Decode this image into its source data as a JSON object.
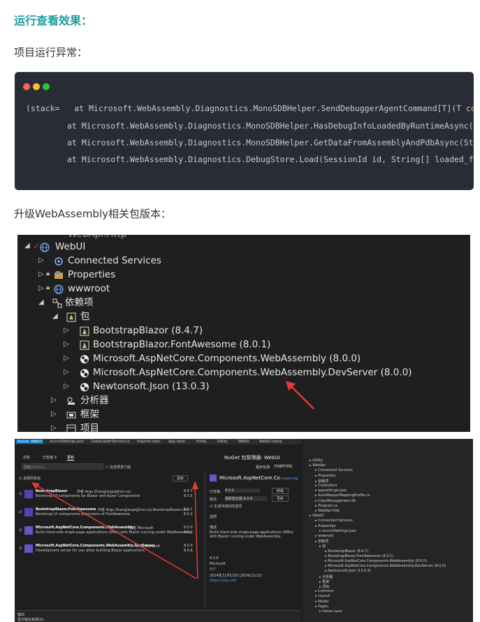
{
  "heading": "运行查看效果：",
  "para1": "项目运行异常：",
  "code": {
    "dots": [
      "#ff5f56",
      "#ffbd2e",
      "#27c93f"
    ],
    "line1_prefix": "(stack=   at Microsoft.WebAssembly.Diagnostics.MonoSDBHelper.SendDebuggerAgentCommand[T](T ",
    "line1_kw": "command",
    "line2": "at Microsoft.WebAssembly.Diagnostics.MonoSDBHelper.HasDebugInfoLoadedByRuntimeAsync(Strin",
    "line3": "at Microsoft.WebAssembly.Diagnostics.MonoSDBHelper.GetDataFromAssemblyAndPdbAsync(String",
    "line4": "at Microsoft.WebAssembly.Diagnostics.DebugStore.Load(SessionId id, String[] loaded_files"
  },
  "para2": "升级WebAssembly相关包版本：",
  "solution_tree": {
    "partial_top": "WebApi.Http",
    "webui": "WebUI",
    "connected_services": "Connected Services",
    "properties": "Properties",
    "wwwroot": "wwwroot",
    "dependencies": "依赖项",
    "packages": "包",
    "pkg1": "BootstrapBlazor (8.4.7)",
    "pkg2": "BootstrapBlazor.FontAwesome (8.0.1)",
    "pkg3": "Microsoft.AspNetCore.Components.WebAssembly (8.0.0)",
    "pkg4": "Microsoft.AspNetCore.Components.WebAssembly.DevServer (8.0.0)",
    "pkg5": "Newtonsoft.Json (13.0.3)",
    "analyzers": "分析器",
    "frameworks": "框架",
    "project": "项目"
  },
  "nuget": {
    "tabs": [
      "NuGet: WebUI",
      "launchSettings.json",
      "DataLoaderService.cs",
      "Imports.razor",
      "App.razor",
      "Entity",
      "Utility",
      "WebUI",
      "WebUI.csproj"
    ],
    "browse": "浏览",
    "installed": "已安装 9",
    "updates": "更新",
    "title": "NuGet 包管理器: WebUI",
    "search": "搜索(Ctrl+L)",
    "prerelease": "包括预发行版",
    "source_label": "程序包源:",
    "source": "nuget.org",
    "select_all": "选择所有包",
    "update_btn": "更新",
    "packages": [
      {
        "name": "BootstrapBlazor",
        "by": "作者 Argo Zhang(argo@live.ca)",
        "desc": "Bootstrap UI components for Blazor and Razor Components",
        "v1": "8.4.7",
        "v2": "8.5.5"
      },
      {
        "name": "BootstrapBlazor.FontAwesome",
        "by": "作者 Argo Zhang(argo@live.ca),BootstrapBlazor.com",
        "desc": "Bootstrap UI components extensions of FontAwesome",
        "v1": "8.0.1",
        "v2": "8.0.2"
      },
      {
        "name": "Microsoft.AspNetCore.Components.WebAssembly",
        "by": "作者 Microsoft",
        "desc": "Build client-side single-page applications (SPAs) with Blazor running under WebAssembly.",
        "v1": "8.0.0",
        "v2": "8.0.6"
      },
      {
        "name": "Microsoft.AspNetCore.Components.WebAssembly.DevServer",
        "by": "作者 Microsoft",
        "desc": "Development server for use when building Blazor applications.",
        "v1": "8.0.0",
        "v2": "8.0.6"
      }
    ],
    "detail": {
      "title": "Microsoft.AspNetCore.Co",
      "link": "nuget.org",
      "installed_label": "已安装:",
      "installed_val": "8.0.0",
      "uninstall": "卸载",
      "version_label": "版本:",
      "version_val": "最新稳定版 8.0.6",
      "update": "更新",
      "option": "生成冲突时的选项",
      "options": "选项",
      "desc_label": "描述",
      "desc": "Build client-side single-page applications (SPAs) with Blazor running under WebAssembly.",
      "version2": "8.0.6",
      "author": "Microsoft",
      "license": "MIT",
      "date": "2024年11月12日 (2024/11/12)",
      "url": "https://asp.net/"
    },
    "right_tree": [
      "Utility",
      "WebApi",
      "Connected Services",
      "Properties",
      "依赖项",
      "Controllers",
      "appsettings.json",
      "AutoMapperMappingProfile.cs",
      "ClassManagement.db",
      "Program.cs",
      "WebApi.http",
      "WebUI",
      "Connected Services",
      "Properties",
      "launchSettings.json",
      "wwwroot",
      "依赖项",
      "包",
      "BootstrapBlazor (8.4.7)",
      "BootstrapBlazor.FontAwesome (8.0.1)",
      "Microsoft.AspNetCore.Components.WebAssembly (8.0.0)",
      "Microsoft.AspNetCore.Components.WebAssembly.DevServer (8.0.0)",
      "Newtonsoft.Json (13.0.3)",
      "分析器",
      "框架",
      "项目",
      "Common",
      "Layout",
      "Model",
      "Pages",
      "Home.razor"
    ],
    "output_label": "输出",
    "output_from": "显示输出来源(S):"
  }
}
